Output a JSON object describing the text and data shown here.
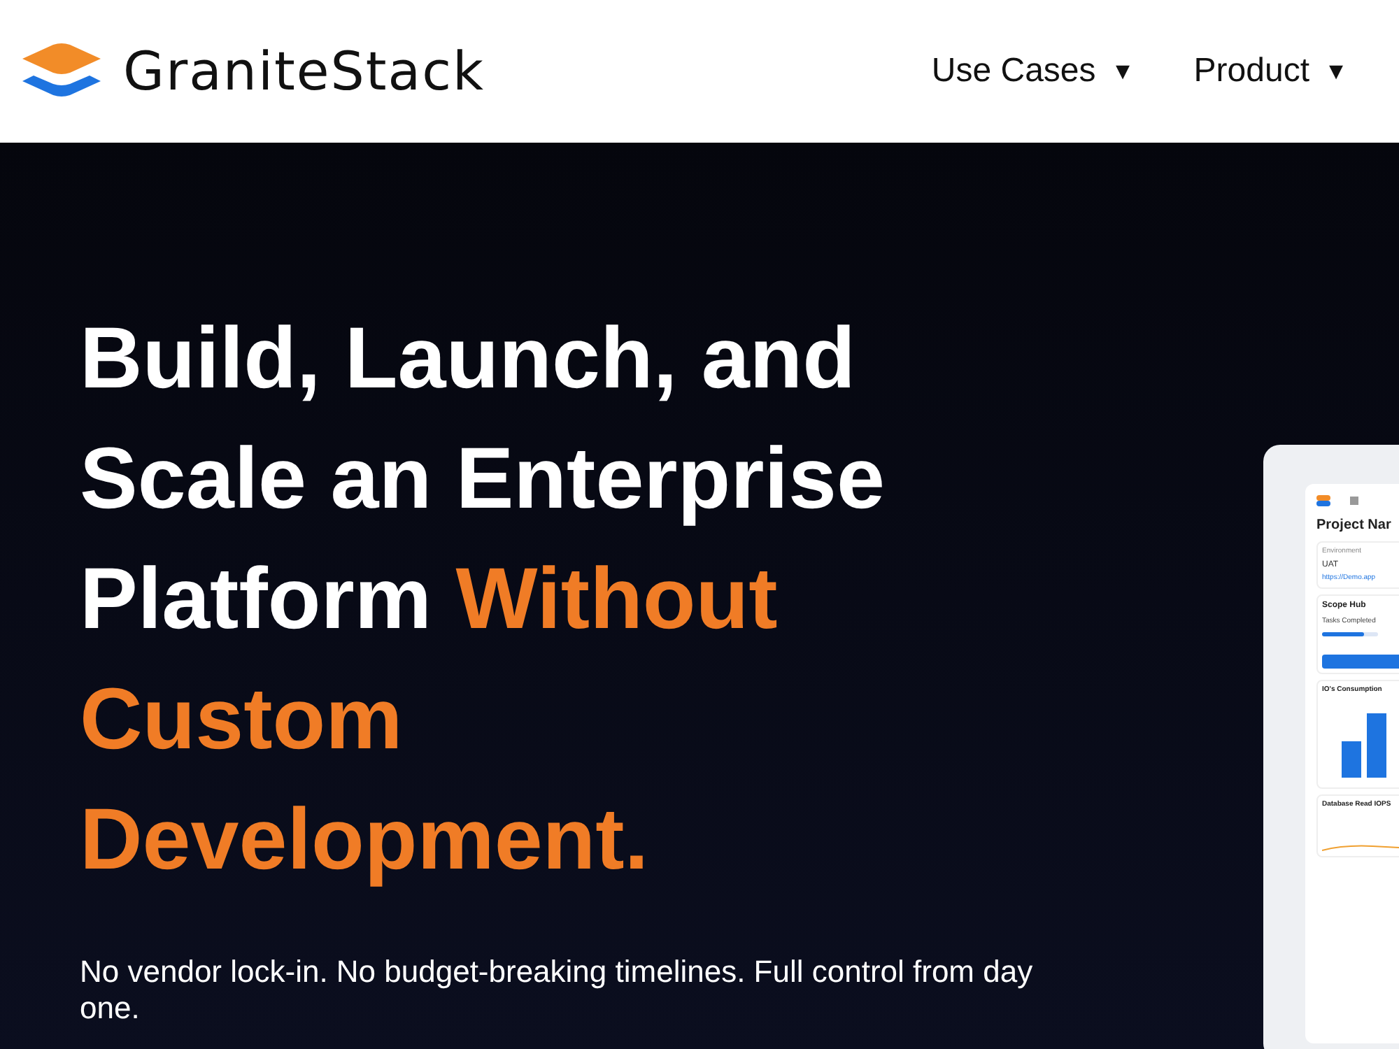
{
  "header": {
    "brand": "GraniteStack",
    "nav": [
      {
        "label": "Use Cases",
        "caret": "▾"
      },
      {
        "label": "Product",
        "caret": "▾"
      }
    ]
  },
  "hero": {
    "headline": "Build, Launch, and Scale an Enterprise Platform ",
    "headline_accent": "Without Custom Development.",
    "subtitle": "No vendor lock-in. No budget-breaking timelines. Full control from day one."
  },
  "preview": {
    "title": "Project Nar",
    "environment_label": "Environment",
    "environment": "UAT",
    "link": "https://Demo.app",
    "card_title": "Scope Hub",
    "tasks_label": "Tasks Completed",
    "progress": {
      "level": 0.75
    },
    "chart1_title": "IO's Consumption",
    "chart2_title": "Database Read IOPS"
  }
}
